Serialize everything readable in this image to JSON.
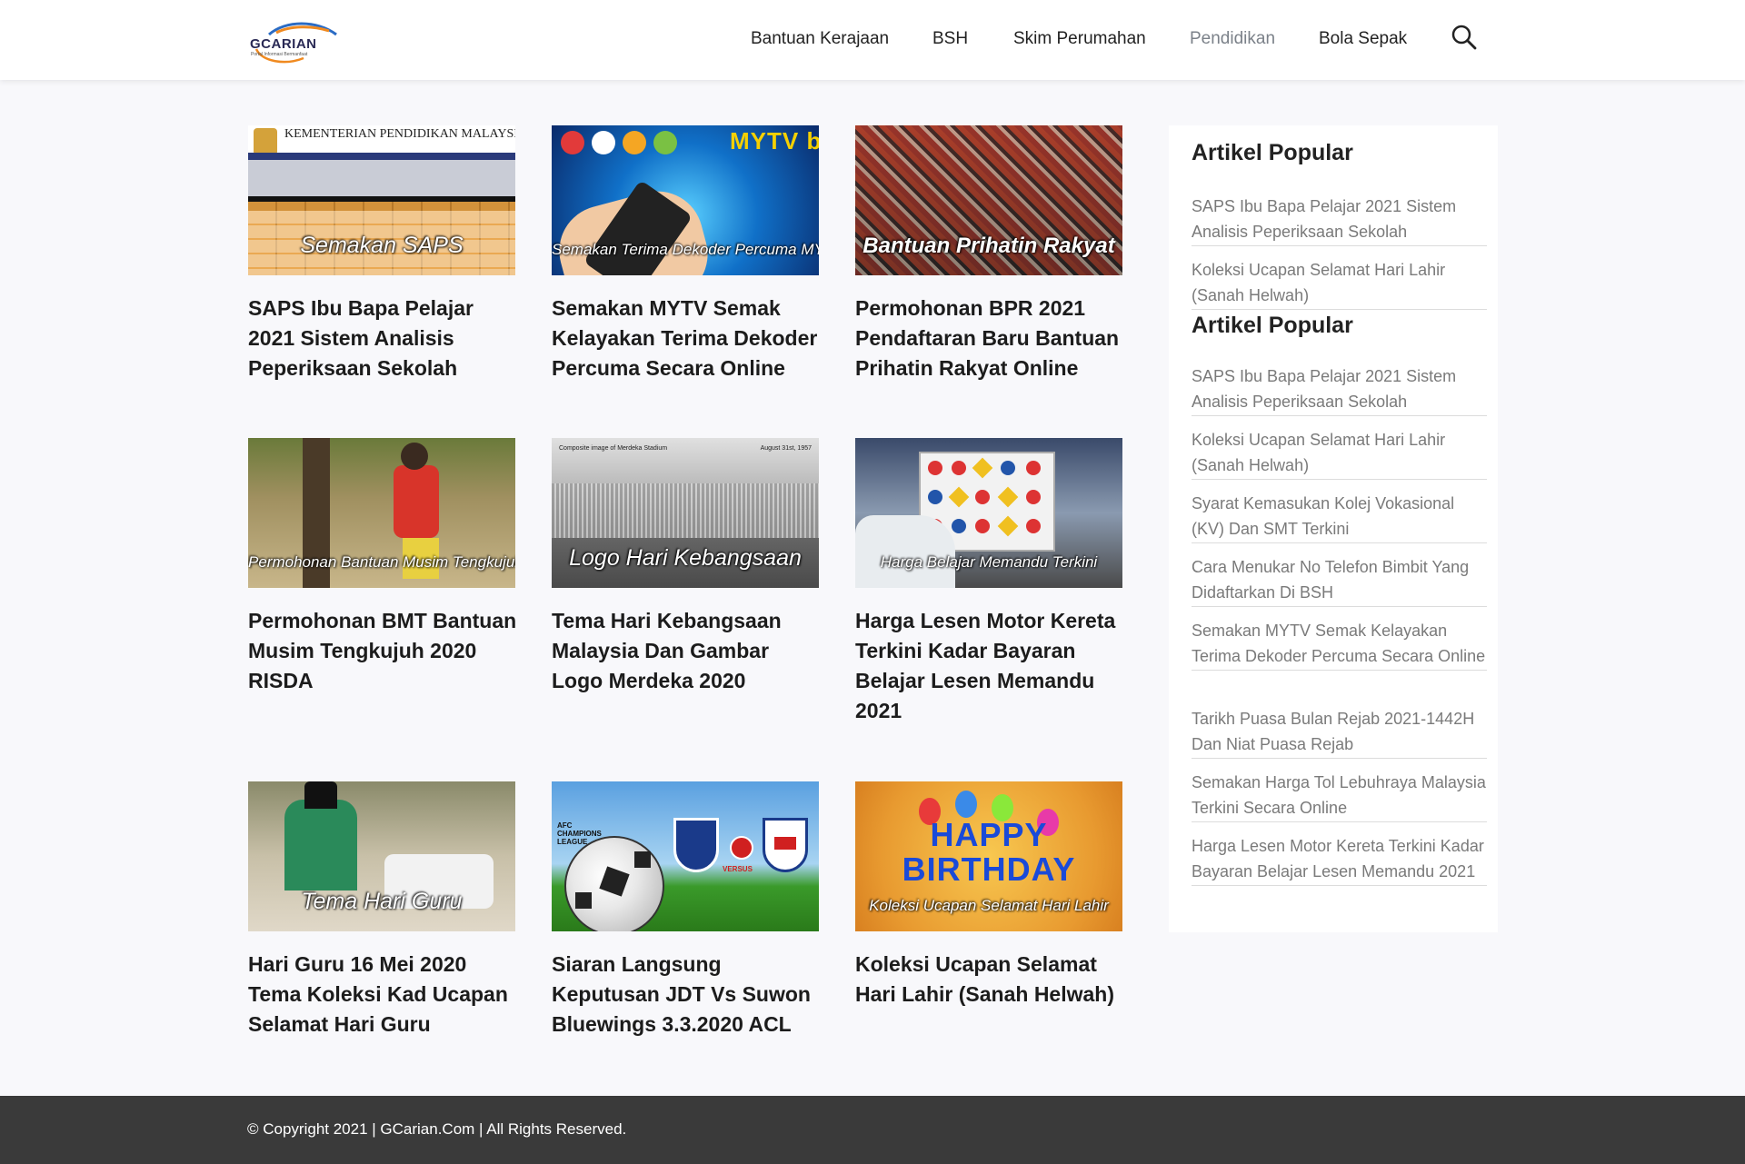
{
  "logo": {
    "name": "GCARIAN",
    "tagline": "Portal Informasi Bermanfaat"
  },
  "nav": {
    "items": [
      {
        "label": "Bantuan Kerajaan",
        "active": false
      },
      {
        "label": "BSH",
        "active": false
      },
      {
        "label": "Skim Perumahan",
        "active": false
      },
      {
        "label": "Pendidikan",
        "active": true
      },
      {
        "label": "Bola Sepak",
        "active": false
      }
    ],
    "search_icon": "search-icon"
  },
  "posts": [
    {
      "caption": "Semakan SAPS",
      "title": "SAPS Ibu Bapa Pelajar 2021 Sistem Analisis Peperiksaan Sekolah",
      "header_text": "KEMENTERIAN PENDIDIKAN MALAYSIA"
    },
    {
      "caption": "Semakan Terima Dekoder Percuma MYTV",
      "title": "Semakan MYTV Semak Kelayakan Terima Dekoder Percuma Secara Online",
      "header_text": "MYTV broadcasting"
    },
    {
      "caption": "Bantuan Prihatin Rakyat",
      "title": "Permohonan BPR 2021 Pendaftaran Baru Bantuan Prihatin Rakyat Online"
    },
    {
      "caption": "Permohonan Bantuan Musim Tengkujuh",
      "title": "Permohonan BMT Bantuan Musim Tengkujuh 2020 RISDA"
    },
    {
      "caption": "Logo Hari Kebangsaan",
      "title": "Tema Hari Kebangsaan Malaysia Dan Gambar Logo Merdeka 2020",
      "header_text": "Composite image of Merdeka Stadium",
      "header_date": "August 31st, 1957"
    },
    {
      "caption": "Harga Belajar Memandu Terkini",
      "title": "Harga Lesen Motor Kereta Terkini Kadar Bayaran Belajar Lesen Memandu 2021"
    },
    {
      "caption": "Tema Hari Guru",
      "title": "Hari Guru 16 Mei 2020 Tema Koleksi Kad Ucapan Selamat Hari Guru"
    },
    {
      "caption": "VERSUS",
      "title": "Siaran Langsung Keputusan JDT Vs Suwon Bluewings 3.3.2020 ACL",
      "header_text": "AFC CHAMPIONS LEAGUE"
    },
    {
      "caption": "Koleksi Ucapan Selamat Hari Lahir",
      "title": "Koleksi Ucapan Selamat Hari Lahir (Sanah Helwah)",
      "header_text": "HAPPY BIRTHDAY"
    }
  ],
  "sidebar": {
    "widget1": {
      "title": "Artikel Popular",
      "links": [
        "SAPS Ibu Bapa Pelajar 2021 Sistem Analisis Peperiksaan Sekolah",
        "Koleksi Ucapan Selamat Hari Lahir (Sanah Helwah)"
      ]
    },
    "widget2": {
      "title": "Artikel Popular",
      "links": [
        "SAPS Ibu Bapa Pelajar 2021 Sistem Analisis Peperiksaan Sekolah",
        "Koleksi Ucapan Selamat Hari Lahir (Sanah Helwah)",
        "Syarat Kemasukan Kolej Vokasional (KV) Dan SMT Terkini",
        "Cara Menukar No Telefon Bimbit Yang Didaftarkan Di BSH",
        "Semakan MYTV Semak Kelayakan Terima Dekoder Percuma Secara Online",
        "Tarikh Puasa Bulan Rejab 2021-1442H Dan Niat Puasa Rejab",
        "Semakan Harga Tol Lebuhraya Malaysia Terkini Secara Online",
        "Harga Lesen Motor Kereta Terkini Kadar Bayaran Belajar Lesen Memandu 2021"
      ]
    }
  },
  "footer": {
    "copyright": "© Copyright 2021 | GCarian.Com | All Rights Reserved."
  },
  "colors": {
    "header_bg": "#ffffff",
    "page_bg": "#f8f8fb",
    "footer_bg": "#3a3a3a",
    "nav_active": "#7b8189",
    "link_muted": "#7a7a7a"
  }
}
